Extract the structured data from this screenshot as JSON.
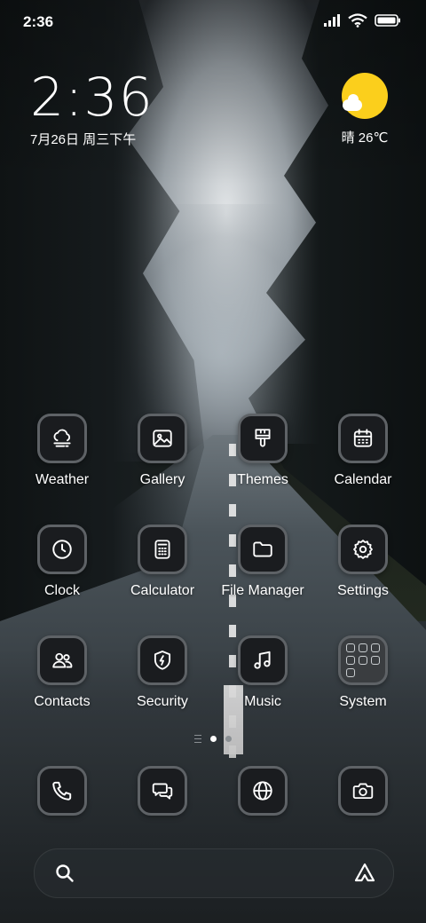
{
  "status_bar": {
    "time": "2:36"
  },
  "clock_widget": {
    "time": "2:36",
    "date": "7月26日 周三下午"
  },
  "weather_widget": {
    "condition_temp": "晴 26℃",
    "icon": "sun-with-cloud-icon"
  },
  "apps": [
    {
      "label": "Weather",
      "icon": "cloud-fog-icon"
    },
    {
      "label": "Gallery",
      "icon": "image-icon"
    },
    {
      "label": "Themes",
      "icon": "paintbrush-icon"
    },
    {
      "label": "Calendar",
      "icon": "calendar-icon"
    },
    {
      "label": "Clock",
      "icon": "clock-icon"
    },
    {
      "label": "Calculator",
      "icon": "calculator-icon"
    },
    {
      "label": "File Manager",
      "icon": "folder-icon"
    },
    {
      "label": "Settings",
      "icon": "gear-icon"
    },
    {
      "label": "Contacts",
      "icon": "contacts-icon"
    },
    {
      "label": "Security",
      "icon": "shield-bolt-icon"
    },
    {
      "label": "Music",
      "icon": "music-note-icon"
    },
    {
      "label": "System",
      "icon": "folder-grid-icon"
    }
  ],
  "dock": [
    {
      "icon": "phone-icon"
    },
    {
      "icon": "messages-icon"
    },
    {
      "icon": "browser-globe-icon"
    },
    {
      "icon": "camera-icon"
    }
  ],
  "pager": {
    "pages": 2,
    "active": 1
  },
  "colors": {
    "icon_bg": "#1a1c1f",
    "icon_border": "#5e6266",
    "sun": "#fbcf1c"
  }
}
